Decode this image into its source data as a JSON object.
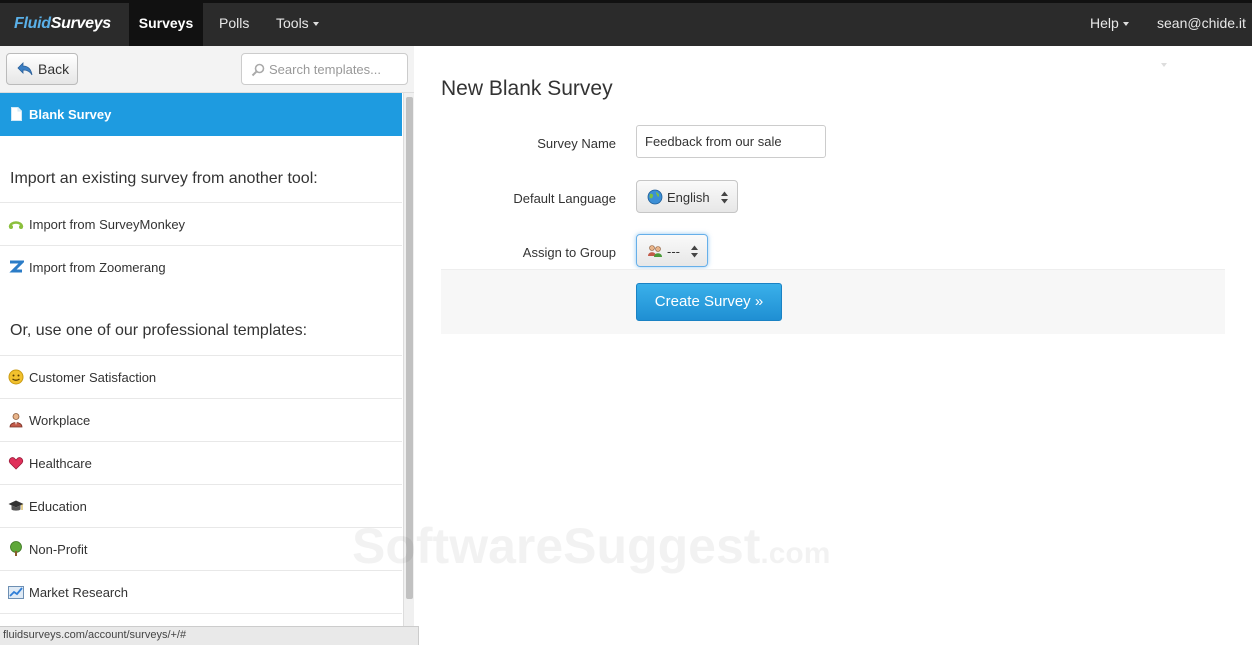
{
  "app": {
    "brand_a": "Fluid",
    "brand_b": "Surveys"
  },
  "navbar": {
    "items": [
      {
        "label": "Surveys",
        "active": true
      },
      {
        "label": "Polls"
      },
      {
        "label": "Tools"
      }
    ],
    "help_label": "Help",
    "user_label": "sean@chide.it"
  },
  "sidebar": {
    "back_label": "Back",
    "search_placeholder": "Search templates...",
    "blank_label": "Blank Survey",
    "import_heading": "Import an existing survey from another tool:",
    "import_items": [
      {
        "label": "Import from SurveyMonkey",
        "icon": "surveymonkey-icon"
      },
      {
        "label": "Import from Zoomerang",
        "icon": "zoomerang-icon"
      }
    ],
    "templates_heading": "Or, use one of our professional templates:",
    "template_items": [
      {
        "label": "Customer Satisfaction",
        "icon": "smiley-icon"
      },
      {
        "label": "Workplace",
        "icon": "worker-icon"
      },
      {
        "label": "Healthcare",
        "icon": "heart-icon"
      },
      {
        "label": "Education",
        "icon": "graduation-cap-icon"
      },
      {
        "label": "Non-Profit",
        "icon": "tree-icon"
      },
      {
        "label": "Market Research",
        "icon": "chart-icon"
      }
    ]
  },
  "main": {
    "title": "New Blank Survey",
    "survey_name_label": "Survey Name",
    "survey_name_value": "Feedback from our sale",
    "language_label": "Default Language",
    "language_value": "English",
    "group_label": "Assign to Group",
    "group_value": "---",
    "create_label": "Create Survey »"
  },
  "status_bar": {
    "url": "fluidsurveys.com/account/surveys/+/#"
  },
  "watermark": {
    "main": "SoftwareSuggest",
    "suffix": ".com"
  },
  "colors": {
    "navbar": "#2b2b2b",
    "accent": "#1e9be0",
    "button": "#2a9fe0"
  }
}
